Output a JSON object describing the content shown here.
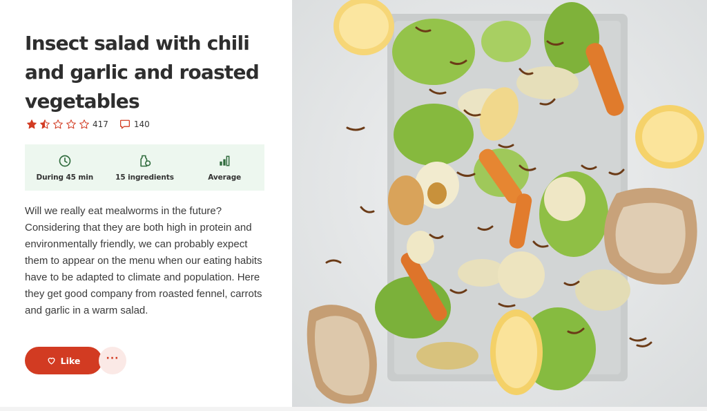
{
  "recipe": {
    "title": "Insect salad with chili and garlic and roasted vegetables",
    "rating": {
      "value": 1.5,
      "max": 5,
      "count": "417"
    },
    "comments": {
      "count": "140"
    },
    "info": [
      {
        "icon": "clock-icon",
        "label": "During 45 min"
      },
      {
        "icon": "ingredients-icon",
        "label": "15 ingredients"
      },
      {
        "icon": "difficulty-bars-icon",
        "label": "Average"
      }
    ],
    "description": "Will we really eat mealworms in the future? Considering that they are both high in protein and environmentally friendly, we can probably expect them to appear on the menu when our eating habits have to be adapted to climate and population. Here they get good company from roasted fennel, carrots and garlic in a warm salad.",
    "actions": {
      "like_label": "Like",
      "more_label": "···"
    }
  },
  "colors": {
    "accent": "#d23b22",
    "info_bg": "#edf7ef",
    "info_icon": "#2f6b3c",
    "more_bg": "#fbe9e6"
  }
}
